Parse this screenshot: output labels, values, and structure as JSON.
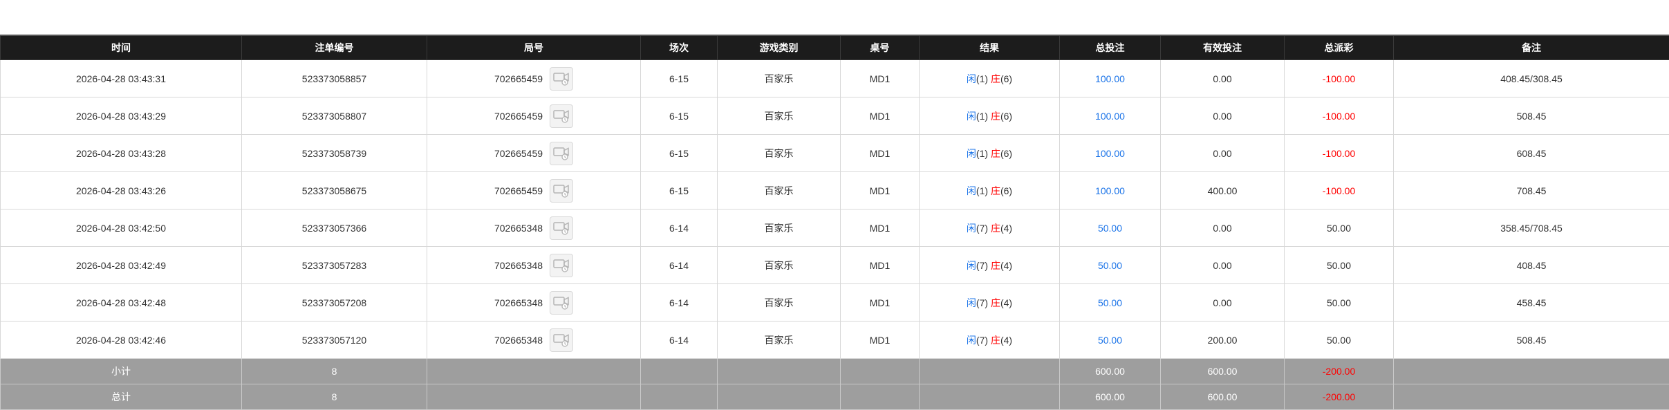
{
  "headers": [
    "时间",
    "注单编号",
    "局号",
    "场次",
    "游戏类别",
    "桌号",
    "结果",
    "总投注",
    "有效投注",
    "总派彩",
    "备注"
  ],
  "rows": [
    {
      "time": "2026-04-28 03:43:31",
      "bet_no": "523373058857",
      "round": "702665459",
      "session": "6-15",
      "game": "百家乐",
      "table": "MD1",
      "res_player": "闲",
      "res_player_pts": "(1)",
      "res_banker": "庄",
      "res_banker_pts": "(6)",
      "total_bet": "100.00",
      "valid_bet": "0.00",
      "payout": "-100.00",
      "remark": "408.45/308.45"
    },
    {
      "time": "2026-04-28 03:43:29",
      "bet_no": "523373058807",
      "round": "702665459",
      "session": "6-15",
      "game": "百家乐",
      "table": "MD1",
      "res_player": "闲",
      "res_player_pts": "(1)",
      "res_banker": "庄",
      "res_banker_pts": "(6)",
      "total_bet": "100.00",
      "valid_bet": "0.00",
      "payout": "-100.00",
      "remark": "508.45"
    },
    {
      "time": "2026-04-28 03:43:28",
      "bet_no": "523373058739",
      "round": "702665459",
      "session": "6-15",
      "game": "百家乐",
      "table": "MD1",
      "res_player": "闲",
      "res_player_pts": "(1)",
      "res_banker": "庄",
      "res_banker_pts": "(6)",
      "total_bet": "100.00",
      "valid_bet": "0.00",
      "payout": "-100.00",
      "remark": "608.45"
    },
    {
      "time": "2026-04-28 03:43:26",
      "bet_no": "523373058675",
      "round": "702665459",
      "session": "6-15",
      "game": "百家乐",
      "table": "MD1",
      "res_player": "闲",
      "res_player_pts": "(1)",
      "res_banker": "庄",
      "res_banker_pts": "(6)",
      "total_bet": "100.00",
      "valid_bet": "400.00",
      "payout": "-100.00",
      "remark": "708.45"
    },
    {
      "time": "2026-04-28 03:42:50",
      "bet_no": "523373057366",
      "round": "702665348",
      "session": "6-14",
      "game": "百家乐",
      "table": "MD1",
      "res_player": "闲",
      "res_player_pts": "(7)",
      "res_banker": "庄",
      "res_banker_pts": "(4)",
      "total_bet": "50.00",
      "valid_bet": "0.00",
      "payout": "50.00",
      "remark": "358.45/708.45"
    },
    {
      "time": "2026-04-28 03:42:49",
      "bet_no": "523373057283",
      "round": "702665348",
      "session": "6-14",
      "game": "百家乐",
      "table": "MD1",
      "res_player": "闲",
      "res_player_pts": "(7)",
      "res_banker": "庄",
      "res_banker_pts": "(4)",
      "total_bet": "50.00",
      "valid_bet": "0.00",
      "payout": "50.00",
      "remark": "408.45"
    },
    {
      "time": "2026-04-28 03:42:48",
      "bet_no": "523373057208",
      "round": "702665348",
      "session": "6-14",
      "game": "百家乐",
      "table": "MD1",
      "res_player": "闲",
      "res_player_pts": "(7)",
      "res_banker": "庄",
      "res_banker_pts": "(4)",
      "total_bet": "50.00",
      "valid_bet": "0.00",
      "payout": "50.00",
      "remark": "458.45"
    },
    {
      "time": "2026-04-28 03:42:46",
      "bet_no": "523373057120",
      "round": "702665348",
      "session": "6-14",
      "game": "百家乐",
      "table": "MD1",
      "res_player": "闲",
      "res_player_pts": "(7)",
      "res_banker": "庄",
      "res_banker_pts": "(4)",
      "total_bet": "50.00",
      "valid_bet": "200.00",
      "payout": "50.00",
      "remark": "508.45"
    }
  ],
  "subtotal": {
    "label": "小计",
    "count": "8",
    "total_bet": "600.00",
    "valid_bet": "600.00",
    "payout": "-200.00"
  },
  "grand_total": {
    "label": "总计",
    "count": "8",
    "total_bet": "600.00",
    "valid_bet": "600.00",
    "payout": "-200.00"
  },
  "icons": {
    "replay": "video-replay-icon"
  },
  "colors": {
    "header_bg": "#1c1c1c",
    "footer_bg": "#9e9e9e",
    "link_blue": "#1a73e8",
    "negative_red": "#ff0000"
  }
}
